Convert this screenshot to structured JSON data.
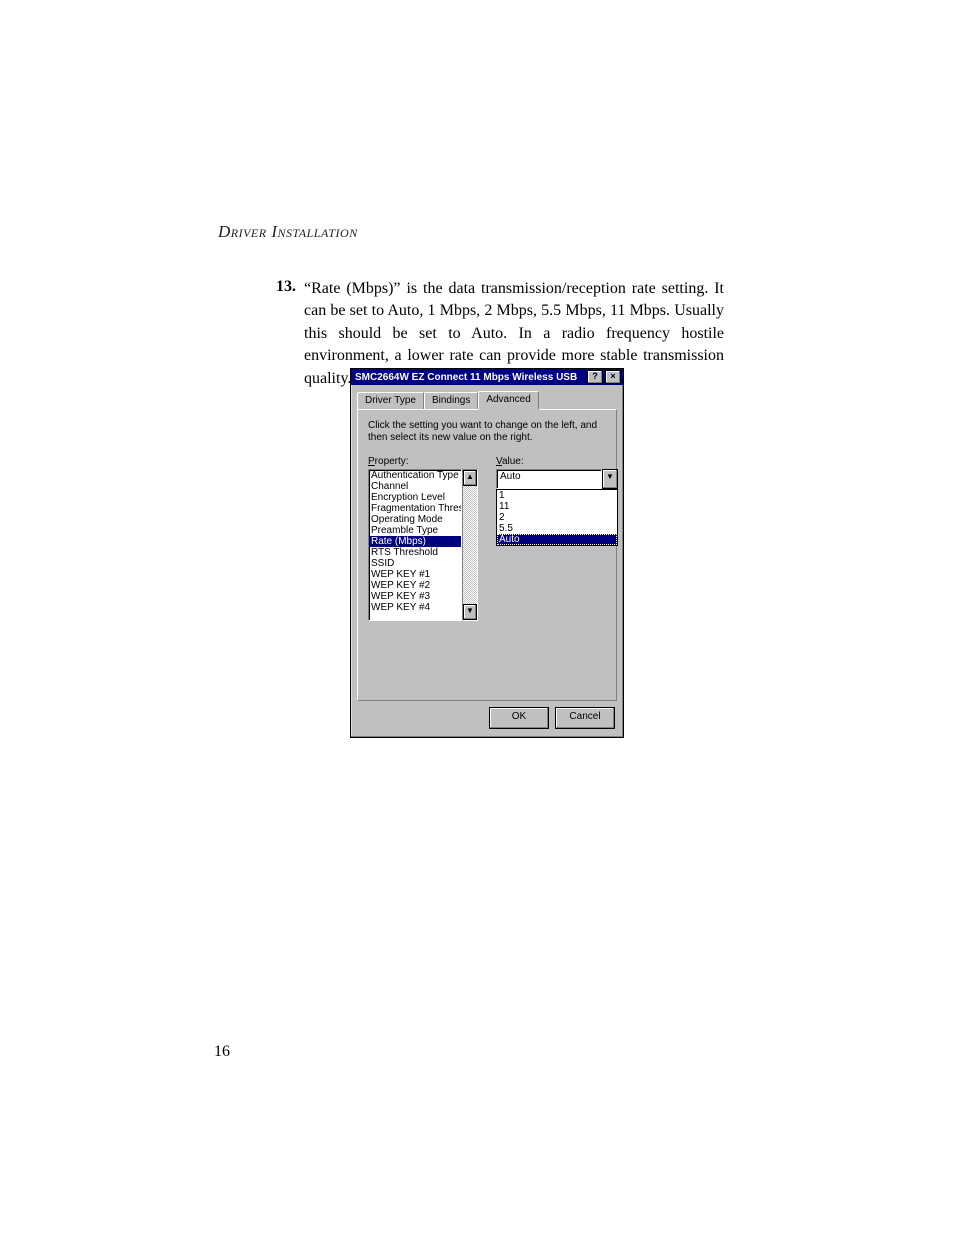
{
  "page": {
    "running_head": "Driver Installation",
    "number": "16",
    "item": {
      "num": "13.",
      "text": "“Rate (Mbps)” is the data transmission/reception rate setting. It can be set to Auto, 1 Mbps, 2 Mbps, 5.5 Mbps, 11 Mbps. Usually this should be set to Auto.  In a radio frequency hostile environment, a lower rate can provide more stable transmission quality."
    }
  },
  "dialog": {
    "title": "SMC2664W EZ Connect 11 Mbps Wireless USB",
    "help": "?",
    "close": "×",
    "tabs": {
      "driver_type": "Driver Type",
      "bindings": "Bindings",
      "advanced": "Advanced"
    },
    "instruction": "Click the setting you want to change on the left, and then select its new value on the right.",
    "property_label_pre": "P",
    "property_label_post": "roperty:",
    "value_label_pre": "V",
    "value_label_post": "alue:",
    "properties": [
      "Authentication Type",
      "Channel",
      "Encryption Level",
      "Fragmentation Threshold",
      "Operating Mode",
      "Preamble Type",
      "Rate (Mbps)",
      "RTS Threshold",
      "SSID",
      "WEP KEY #1",
      "WEP KEY #2",
      "WEP KEY #3",
      "WEP KEY #4"
    ],
    "selected_property_index": 6,
    "value_selected": "Auto",
    "value_options": [
      "1",
      "11",
      "2",
      "5.5",
      "Auto"
    ],
    "value_selected_option_index": 4,
    "scroll_up": "▲",
    "scroll_down": "▼",
    "combo_down": "▼",
    "ok": "OK",
    "cancel": "Cancel"
  }
}
